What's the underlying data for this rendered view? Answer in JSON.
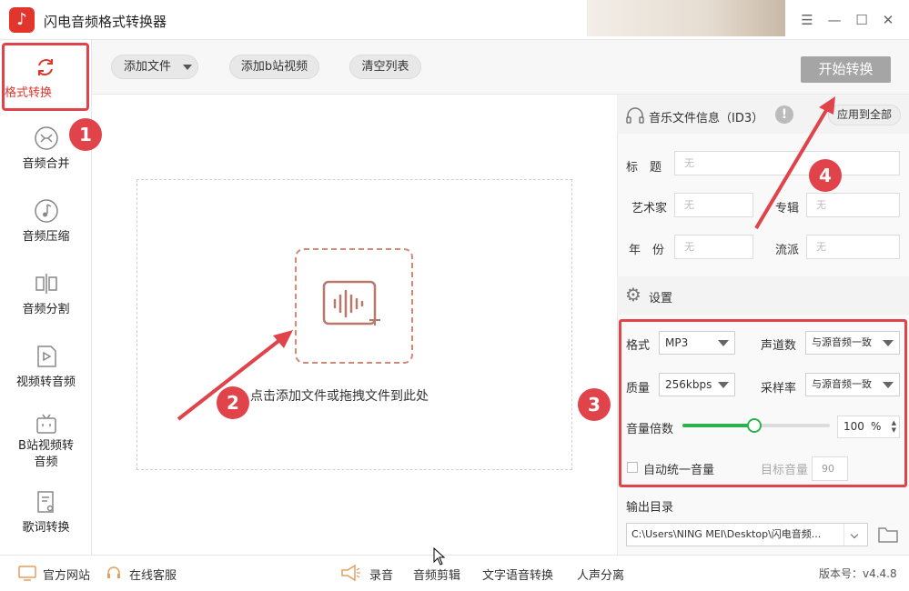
{
  "app": {
    "title": "闪电音频格式转换器",
    "logo_glyph": "♪"
  },
  "window": {
    "menu": "☰",
    "minimize": "—",
    "maximize": "☐",
    "close": "✕"
  },
  "sidebar": {
    "items": [
      {
        "label": "格式转换",
        "icon": "refresh-icon"
      },
      {
        "label": "音频合并",
        "icon": "merge-icon"
      },
      {
        "label": "音频压缩",
        "icon": "music-note-icon"
      },
      {
        "label": "音频分割",
        "icon": "split-icon"
      },
      {
        "label": "视频转音频",
        "icon": "video-play-icon"
      },
      {
        "label_l1": "B站视频转",
        "label_l2": "音频",
        "icon": "tv-icon"
      },
      {
        "label": "歌词转换",
        "icon": "lyrics-icon"
      }
    ]
  },
  "toolbar": {
    "add_file": "添加文件",
    "add_bilibili": "添加b站视频",
    "clear_list": "清空列表",
    "start": "开始转换"
  },
  "dropzone": {
    "text": "点击添加文件或拖拽文件到此处"
  },
  "id3": {
    "title": "音乐文件信息（ID3）",
    "apply_all": "应用到全部",
    "title_label": "标　题",
    "artist_label": "艺术家",
    "album_label": "专辑",
    "year_label": "年　份",
    "genre_label": "流派",
    "placeholder": "无"
  },
  "settings": {
    "title": "设置",
    "format_label": "格式",
    "format_value": "MP3",
    "channels_label": "声道数",
    "channels_value": "与源音频一致",
    "quality_label": "质量",
    "quality_value": "256kbps",
    "samplerate_label": "采样率",
    "samplerate_value": "与源音频一致",
    "volume_label": "音量倍数",
    "volume_value": "100",
    "volume_unit": "%",
    "volume_fraction": 0.49,
    "auto_volume_label": "自动统一音量",
    "target_volume_label": "目标音量",
    "target_volume_value": "90"
  },
  "output": {
    "label": "输出目录",
    "path": "C:\\Users\\NING MEI\\Desktop\\闪电音频..."
  },
  "statusbar": {
    "website": "官方网站",
    "support": "在线客服",
    "record": "录音",
    "audio_edit": "音频剪辑",
    "tts": "文字语音转换",
    "vocal_sep": "人声分离",
    "version": "版本号：v4.4.8"
  },
  "annotations": {
    "b1": "1",
    "b2": "2",
    "b3": "3",
    "b4": "4"
  },
  "colors": {
    "accent": "#e2352c",
    "annotation": "#e0434a",
    "slider": "#2bb24c",
    "start_btn": "#a5a5a5"
  }
}
